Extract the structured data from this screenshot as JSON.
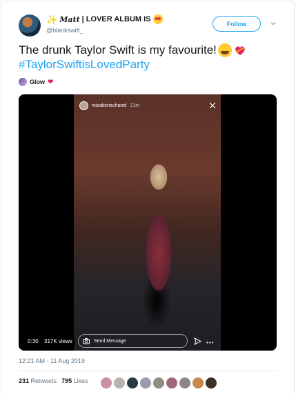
{
  "user": {
    "display_prefix": "✨",
    "display_name_script": "Matt",
    "display_name_rest": "| LOVER ALBUM IS",
    "handle": "@blankswift_"
  },
  "follow_button": {
    "label": "Follow"
  },
  "tweet": {
    "text": "The drunk Taylor Swift is my favourite!",
    "hashtag": "#TaylorSwiftisLovedParty"
  },
  "music": {
    "label": "Glow",
    "heart": "❤"
  },
  "video": {
    "ig_username": "mizakeriachanel",
    "ig_time": "21m",
    "duration": "0:30",
    "views": "317K views",
    "send_message_placeholder": "Send Message",
    "more": "•••"
  },
  "timestamp": "12:21 AM - 11 Aug 2019",
  "stats": {
    "retweets_count": "231",
    "retweets_label": "Retweets",
    "likes_count": "795",
    "likes_label": "Likes"
  },
  "colors": {
    "accent": "#1da1f2",
    "text": "#14171a",
    "muted": "#657786",
    "heart": "#e0245e"
  },
  "liker_avatars": [
    "#c98fa7",
    "#b8b3ad",
    "#2a3a44",
    "#9b9bb0",
    "#8d8d80",
    "#a0667a",
    "#8b8585",
    "#c9874d",
    "#3b3026"
  ]
}
